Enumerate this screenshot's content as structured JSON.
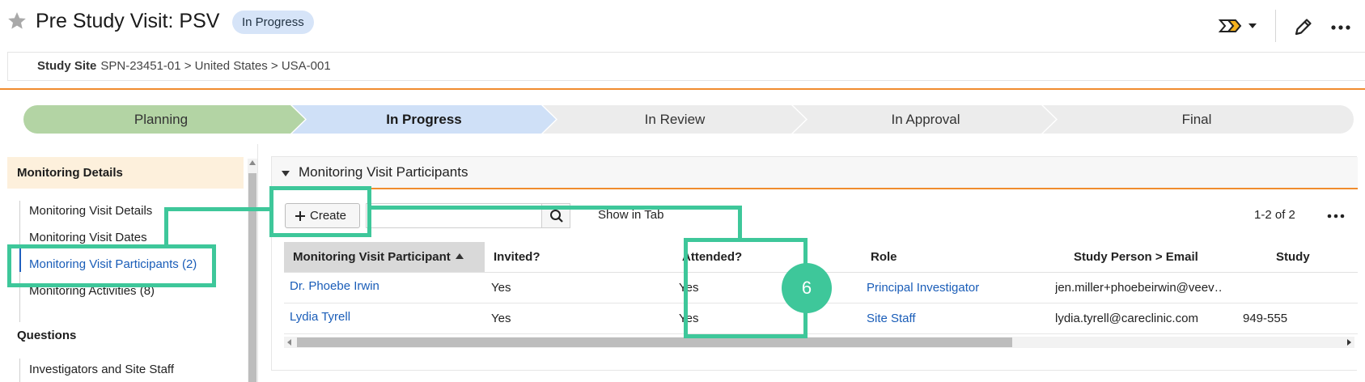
{
  "header": {
    "title": "Pre Study Visit: PSV",
    "status": "In Progress",
    "star_icon": "star-icon",
    "workflow_icon": "workflow-menu-icon",
    "edit_icon": "pencil-icon",
    "more_icon": "more-options-icon"
  },
  "breadcrumb": {
    "label": "Study Site",
    "path": "SPN-23451-01 > United States > USA-001"
  },
  "lifecycle": {
    "stages": [
      "Planning",
      "In Progress",
      "In Review",
      "In Approval",
      "Final"
    ],
    "current": "In Progress",
    "colors": {
      "done": "#b3d4a4",
      "current": "#cfe0f7",
      "pending": "#ececec"
    }
  },
  "sidenav": {
    "header": "Monitoring Details",
    "items": [
      "Monitoring Visit Details",
      "Monitoring Visit Dates",
      "Monitoring Visit Participants (2)",
      "Monitoring Activities (8)"
    ],
    "active_item": "Monitoring Visit Participants (2)",
    "section": "Questions",
    "section_items": [
      "Investigators and Site Staff"
    ]
  },
  "panel": {
    "title": "Monitoring Visit Participants",
    "create_label": "Create",
    "search_placeholder": "",
    "show_in_tab": "Show in Tab",
    "pager": "1-2 of 2"
  },
  "table": {
    "columns": [
      "Monitoring Visit Participant",
      "Invited?",
      "Attended?",
      "Role",
      "Study Person > Email",
      "Study"
    ],
    "sorted_column": "Monitoring Visit Participant",
    "rows": [
      {
        "participant": "Dr. Phoebe Irwin",
        "invited": "Yes",
        "attended": "Yes",
        "role": "Principal Investigator",
        "email": "jen.miller+phoebeirwin@veev…",
        "study": ""
      },
      {
        "participant": "Lydia Tyrell",
        "invited": "Yes",
        "attended": "Yes",
        "role": "Site Staff",
        "email": "lydia.tyrell@careclinic.com",
        "study": "949-555"
      }
    ]
  },
  "annotation": {
    "badge": "6",
    "color": "#3ec79a"
  }
}
